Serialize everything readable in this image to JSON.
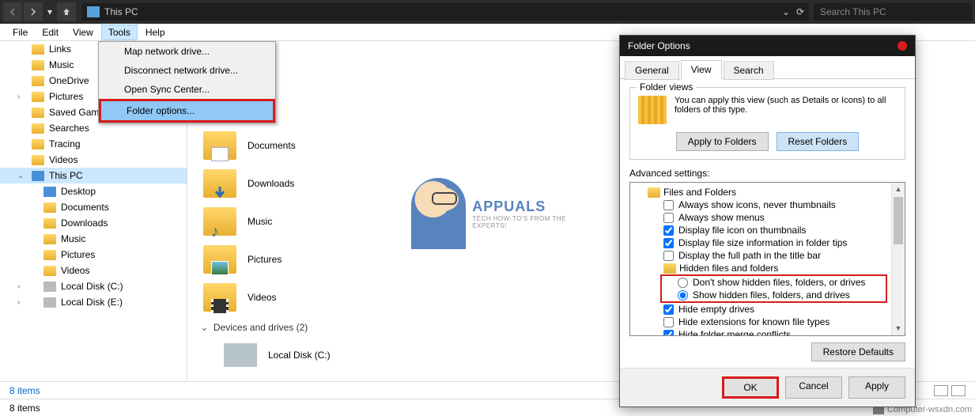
{
  "topbar": {
    "location": "This PC",
    "search_placeholder": "Search This PC"
  },
  "menubar": {
    "file": "File",
    "edit": "Edit",
    "view": "View",
    "tools": "Tools",
    "help": "Help"
  },
  "dropdown": {
    "map": "Map network drive...",
    "disconnect": "Disconnect network drive...",
    "sync": "Open Sync Center...",
    "folder_options": "Folder options..."
  },
  "sidebar": {
    "links": "Links",
    "music": "Music",
    "onedrive": "OneDrive",
    "pictures": "Pictures",
    "savedgames": "Saved Games",
    "searches": "Searches",
    "tracing": "Tracing",
    "videos": "Videos",
    "thispc": "This PC",
    "desktop": "Desktop",
    "documents": "Documents",
    "downloads": "Downloads",
    "music2": "Music",
    "pictures2": "Pictures",
    "videos2": "Videos",
    "diskC": "Local Disk (C:)",
    "diskE": "Local Disk (E:)"
  },
  "content": {
    "documents": "Documents",
    "downloads": "Downloads",
    "music": "Music",
    "pictures": "Pictures",
    "videos": "Videos",
    "devices_header": "Devices and drives (2)",
    "diskC": "Local Disk (C:)"
  },
  "watermark": {
    "name": "APPUALS",
    "tag": "TECH HOW-TO'S FROM THE EXPERTS!"
  },
  "status": {
    "items": "8 items",
    "items2": "8 items"
  },
  "dialog": {
    "title": "Folder Options",
    "tabs": {
      "general": "General",
      "view": "View",
      "search": "Search"
    },
    "folder_views": {
      "title": "Folder views",
      "text": "You can apply this view (such as Details or Icons) to all folders of this type.",
      "apply": "Apply to Folders",
      "reset": "Reset Folders"
    },
    "advanced": {
      "label": "Advanced settings:",
      "files_folders": "Files and Folders",
      "icons_never": "Always show icons, never thumbnails",
      "show_menus": "Always show menus",
      "file_icon": "Display file icon on thumbnails",
      "size_info": "Display file size information in folder tips",
      "full_path": "Display the full path in the title bar",
      "hidden": "Hidden files and folders",
      "dont_show": "Don't show hidden files, folders, or drives",
      "show_hidden": "Show hidden files, folders, and drives",
      "hide_empty": "Hide empty drives",
      "hide_ext": "Hide extensions for known file types",
      "hide_merge": "Hide folder merge conflicts",
      "restore": "Restore Defaults"
    },
    "buttons": {
      "ok": "OK",
      "cancel": "Cancel",
      "apply": "Apply"
    }
  },
  "corner": "Computer-wsxdn.com"
}
